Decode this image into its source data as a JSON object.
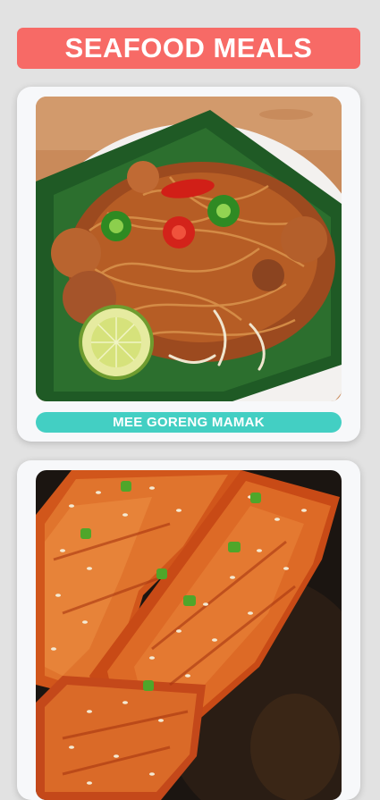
{
  "header": {
    "title": "SEAFOOD MEALS"
  },
  "meals": [
    {
      "name": "MEE GORENG MAMAK",
      "image": "mee-goreng-mamak-photo"
    },
    {
      "name": "",
      "image": "glazed-salmon-photo"
    }
  ],
  "colors": {
    "background": "#e2e2e2",
    "header": "#f76a66",
    "card": "#f7f8fa",
    "label": "#43cfc3"
  }
}
